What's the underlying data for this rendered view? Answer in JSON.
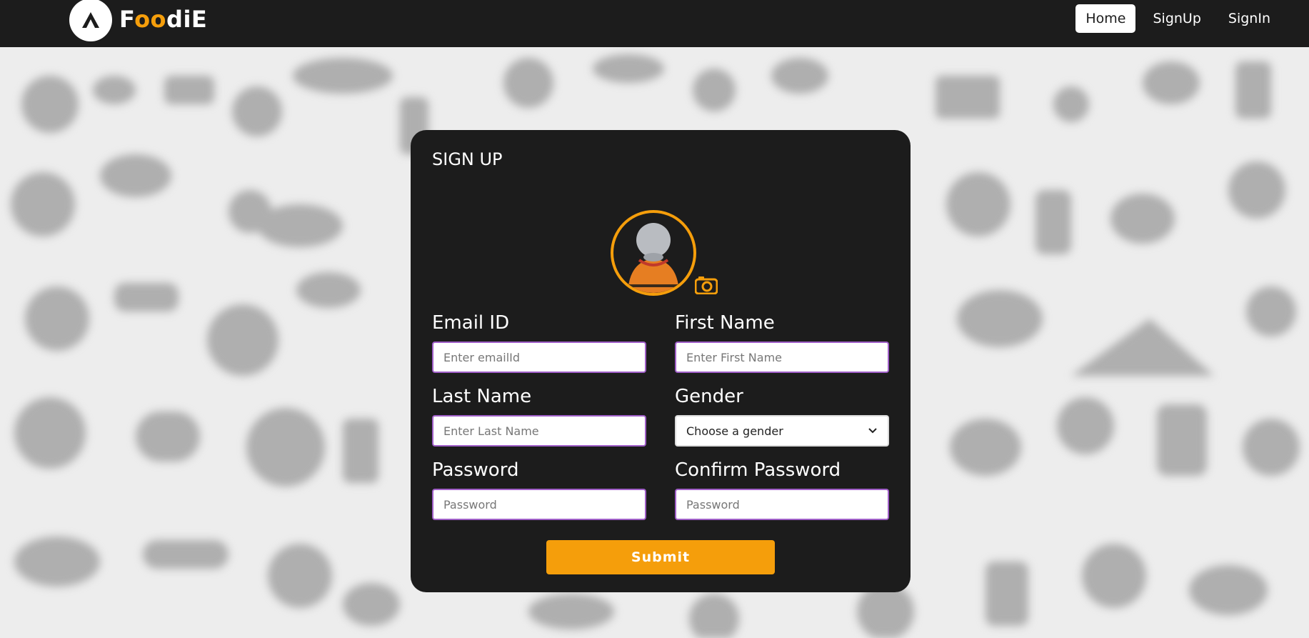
{
  "brand": {
    "name_prefix": "F",
    "name_oo": "oo",
    "name_suffix": "diE"
  },
  "nav": {
    "items": [
      {
        "label": "Home",
        "active": true
      },
      {
        "label": "SignUp",
        "active": false
      },
      {
        "label": "SignIn",
        "active": false
      }
    ]
  },
  "form": {
    "title": "SIGN UP",
    "email": {
      "label": "Email ID",
      "placeholder": "Enter emailId"
    },
    "first_name": {
      "label": "First Name",
      "placeholder": "Enter First Name"
    },
    "last_name": {
      "label": "Last Name",
      "placeholder": "Enter Last Name"
    },
    "gender": {
      "label": "Gender",
      "selected": "Choose a gender"
    },
    "password": {
      "label": "Password",
      "placeholder": "Password"
    },
    "confirm_password": {
      "label": "Confirm Password",
      "placeholder": "Password"
    },
    "submit_label": "Submit"
  },
  "colors": {
    "accent": "#f59e0b",
    "navbar": "#1c1c1c",
    "card": "#1c1c1c",
    "input_border": "#a05fc8"
  },
  "icons": {
    "logo": "triangle-logo-icon",
    "avatar": "user-avatar-icon",
    "camera": "camera-icon",
    "dropdown": "chevron-down-icon"
  }
}
